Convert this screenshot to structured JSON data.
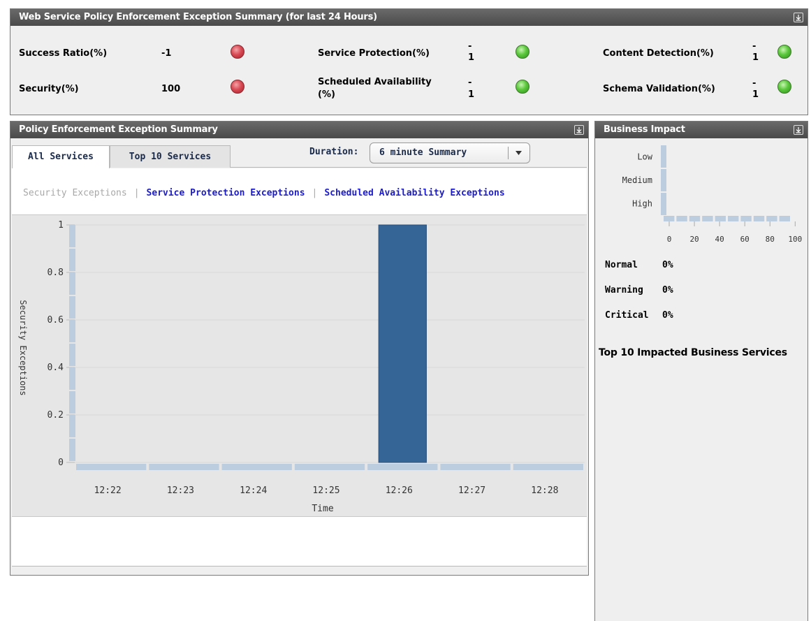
{
  "summary": {
    "title": "Web Service Policy Enforcement Exception Summary (for last 24 Hours)",
    "metrics": [
      {
        "label": "Success Ratio(%)",
        "value": "-1",
        "status": "red"
      },
      {
        "label": "Security(%)",
        "value": "100",
        "status": "red"
      },
      {
        "label": "Service Protection(%)",
        "value_top": "-",
        "value_bottom": "1",
        "status": "green"
      },
      {
        "label_line1": "Scheduled Availability",
        "label_line2": "(%)",
        "value_top": "-",
        "value_bottom": "1",
        "status": "green"
      },
      {
        "label": "Content Detection(%)",
        "value_top": "-",
        "value_bottom": "1",
        "status": "green"
      },
      {
        "label": "Schema Validation(%)",
        "value_top": "-",
        "value_bottom": "1",
        "status": "green"
      }
    ]
  },
  "policy": {
    "title": "Policy Enforcement Exception Summary",
    "tabs": [
      "All Services",
      "Top 10 Services"
    ],
    "active_tab": "All Services",
    "duration_label": "Duration:",
    "duration_value": "6 minute Summary",
    "links": [
      {
        "label": "Security Exceptions",
        "state": "current"
      },
      {
        "label": "Service Protection Exceptions",
        "state": "link"
      },
      {
        "label": "Scheduled Availability Exceptions",
        "state": "link"
      }
    ]
  },
  "chart_data": {
    "type": "bar",
    "categories": [
      "12:22",
      "12:23",
      "12:24",
      "12:25",
      "12:26",
      "12:27",
      "12:28"
    ],
    "values": [
      0,
      0,
      0,
      0,
      1,
      0,
      0
    ],
    "xlabel": "Time",
    "ylabel": "Security Exceptions",
    "ylim": [
      0,
      1
    ],
    "yticks": [
      "0",
      "0.2",
      "0.4",
      "0.6",
      "0.8",
      "1"
    ],
    "grid": true,
    "colors": {
      "bar": "#356496",
      "axis": "#bccddf",
      "plot_bg": "#e6e6e6"
    }
  },
  "impact": {
    "title": "Business Impact",
    "chart_data": {
      "type": "bar",
      "orientation": "horizontal",
      "categories": [
        "Low",
        "Medium",
        "High"
      ],
      "values": [
        0,
        0,
        0
      ],
      "xticks": [
        "0",
        "20",
        "40",
        "60",
        "80",
        "100"
      ],
      "xlim": [
        0,
        100
      ]
    },
    "legend": [
      {
        "label": "Normal",
        "value": "0%"
      },
      {
        "label": "Warning",
        "value": "0%"
      },
      {
        "label": "Critical",
        "value": "0%"
      }
    ],
    "top10_title": "Top 10 Impacted Business Services"
  },
  "colors": {
    "header_bg": "#555555",
    "link": "#1c1cc8",
    "disabled_link": "#a8a8a8",
    "red_status": "#d94b55",
    "green_status": "#5bc83c"
  }
}
